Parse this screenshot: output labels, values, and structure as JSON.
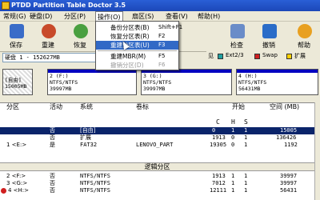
{
  "window": {
    "title": "PTDD Partition Table Doctor 3.5"
  },
  "menu": [
    "常规(G)",
    "硬盘(D)",
    "分区(P)",
    "操作(O)",
    "扇区(S)",
    "查看(V)",
    "帮助(H)"
  ],
  "toolbar": {
    "buttons": [
      {
        "label": "保存",
        "icon": "save-icon",
        "color": "#3a6cc8"
      },
      {
        "label": "重建",
        "icon": "rebuild-icon",
        "color": "#c84a2a"
      },
      {
        "label": "恢复",
        "icon": "recover-icon",
        "color": "#4aa040"
      },
      {
        "label": "检查",
        "icon": "check-icon",
        "color": "#6a8cc8"
      },
      {
        "label": "撤销",
        "icon": "undo-icon",
        "color": "#2a6cc8"
      },
      {
        "label": "帮助",
        "icon": "help-icon",
        "color": "#e8a020"
      }
    ]
  },
  "dropdown": {
    "items": [
      {
        "label": "备份分区表(B)",
        "shortcut": "Shift+F1",
        "state": "normal"
      },
      {
        "label": "恢复分区表(R)",
        "shortcut": "F2",
        "state": "normal"
      },
      {
        "label": "重建分区表(U)",
        "shortcut": "F3",
        "state": "highlighted"
      },
      {
        "label": "重建MBR(M)",
        "shortcut": "F5",
        "state": "normal"
      },
      {
        "label": "撤销分区(D)",
        "shortcut": "F6",
        "state": "disabled"
      }
    ]
  },
  "drive": {
    "value": "硬盘 1 - 152627MB"
  },
  "legend": [
    {
      "label": "Ext2/3",
      "color": "#20a0a0"
    },
    {
      "label": "Swap",
      "color": "#d02020"
    },
    {
      "label": "扩展",
      "color": "#ffd000"
    }
  ],
  "legend_prefix": "见",
  "blocks": [
    {
      "line1": "[自由]",
      "line2": "15005MB",
      "color": "#ffffff"
    },
    {
      "line1": "2 (F:)",
      "line2": "NTFS/NTFS",
      "line3": "39997MB",
      "color": "#0000c0"
    },
    {
      "line1": "3 (G:)",
      "line2": "NTFS/NTFS",
      "line3": "39997MB",
      "color": "#0000c0"
    },
    {
      "line1": "4 (H:)",
      "line2": "NTFS/NTFS",
      "line3": "56431MB",
      "color": "#0000c0"
    }
  ],
  "list": {
    "headers": [
      "分区",
      "活动",
      "系统",
      "卷标",
      "开始",
      "空间 (MB)"
    ],
    "subheaders": [
      "C",
      "H",
      "S"
    ],
    "rows": [
      {
        "idx": "",
        "active": "否",
        "system": "[自由]",
        "label": "",
        "c": "0",
        "h": "1",
        "s": "1",
        "size": "15005",
        "selected": true
      },
      {
        "idx": "",
        "active": "否",
        "system": "扩展",
        "label": "",
        "c": "1913",
        "h": "0",
        "s": "1",
        "size": "136426"
      },
      {
        "idx": "1 <E:>",
        "active": "是",
        "system": "FAT32",
        "label": "LENOVO_PART",
        "c": "19305",
        "h": "0",
        "s": "1",
        "size": "1192"
      }
    ],
    "logical_header": "逻辑分区",
    "logical_rows": [
      {
        "idx": "2 <F:>",
        "active": "否",
        "system": "NTFS/NTFS",
        "label": "",
        "c": "1913",
        "h": "1",
        "s": "1",
        "size": "39997"
      },
      {
        "idx": "3 <G:>",
        "active": "否",
        "system": "NTFS/NTFS",
        "label": "",
        "c": "7012",
        "h": "1",
        "s": "1",
        "size": "39997"
      },
      {
        "idx": "4 <H:>",
        "active": "否",
        "system": "NTFS/NTFS",
        "label": "",
        "c": "12111",
        "h": "1",
        "s": "1",
        "size": "56431"
      }
    ]
  }
}
